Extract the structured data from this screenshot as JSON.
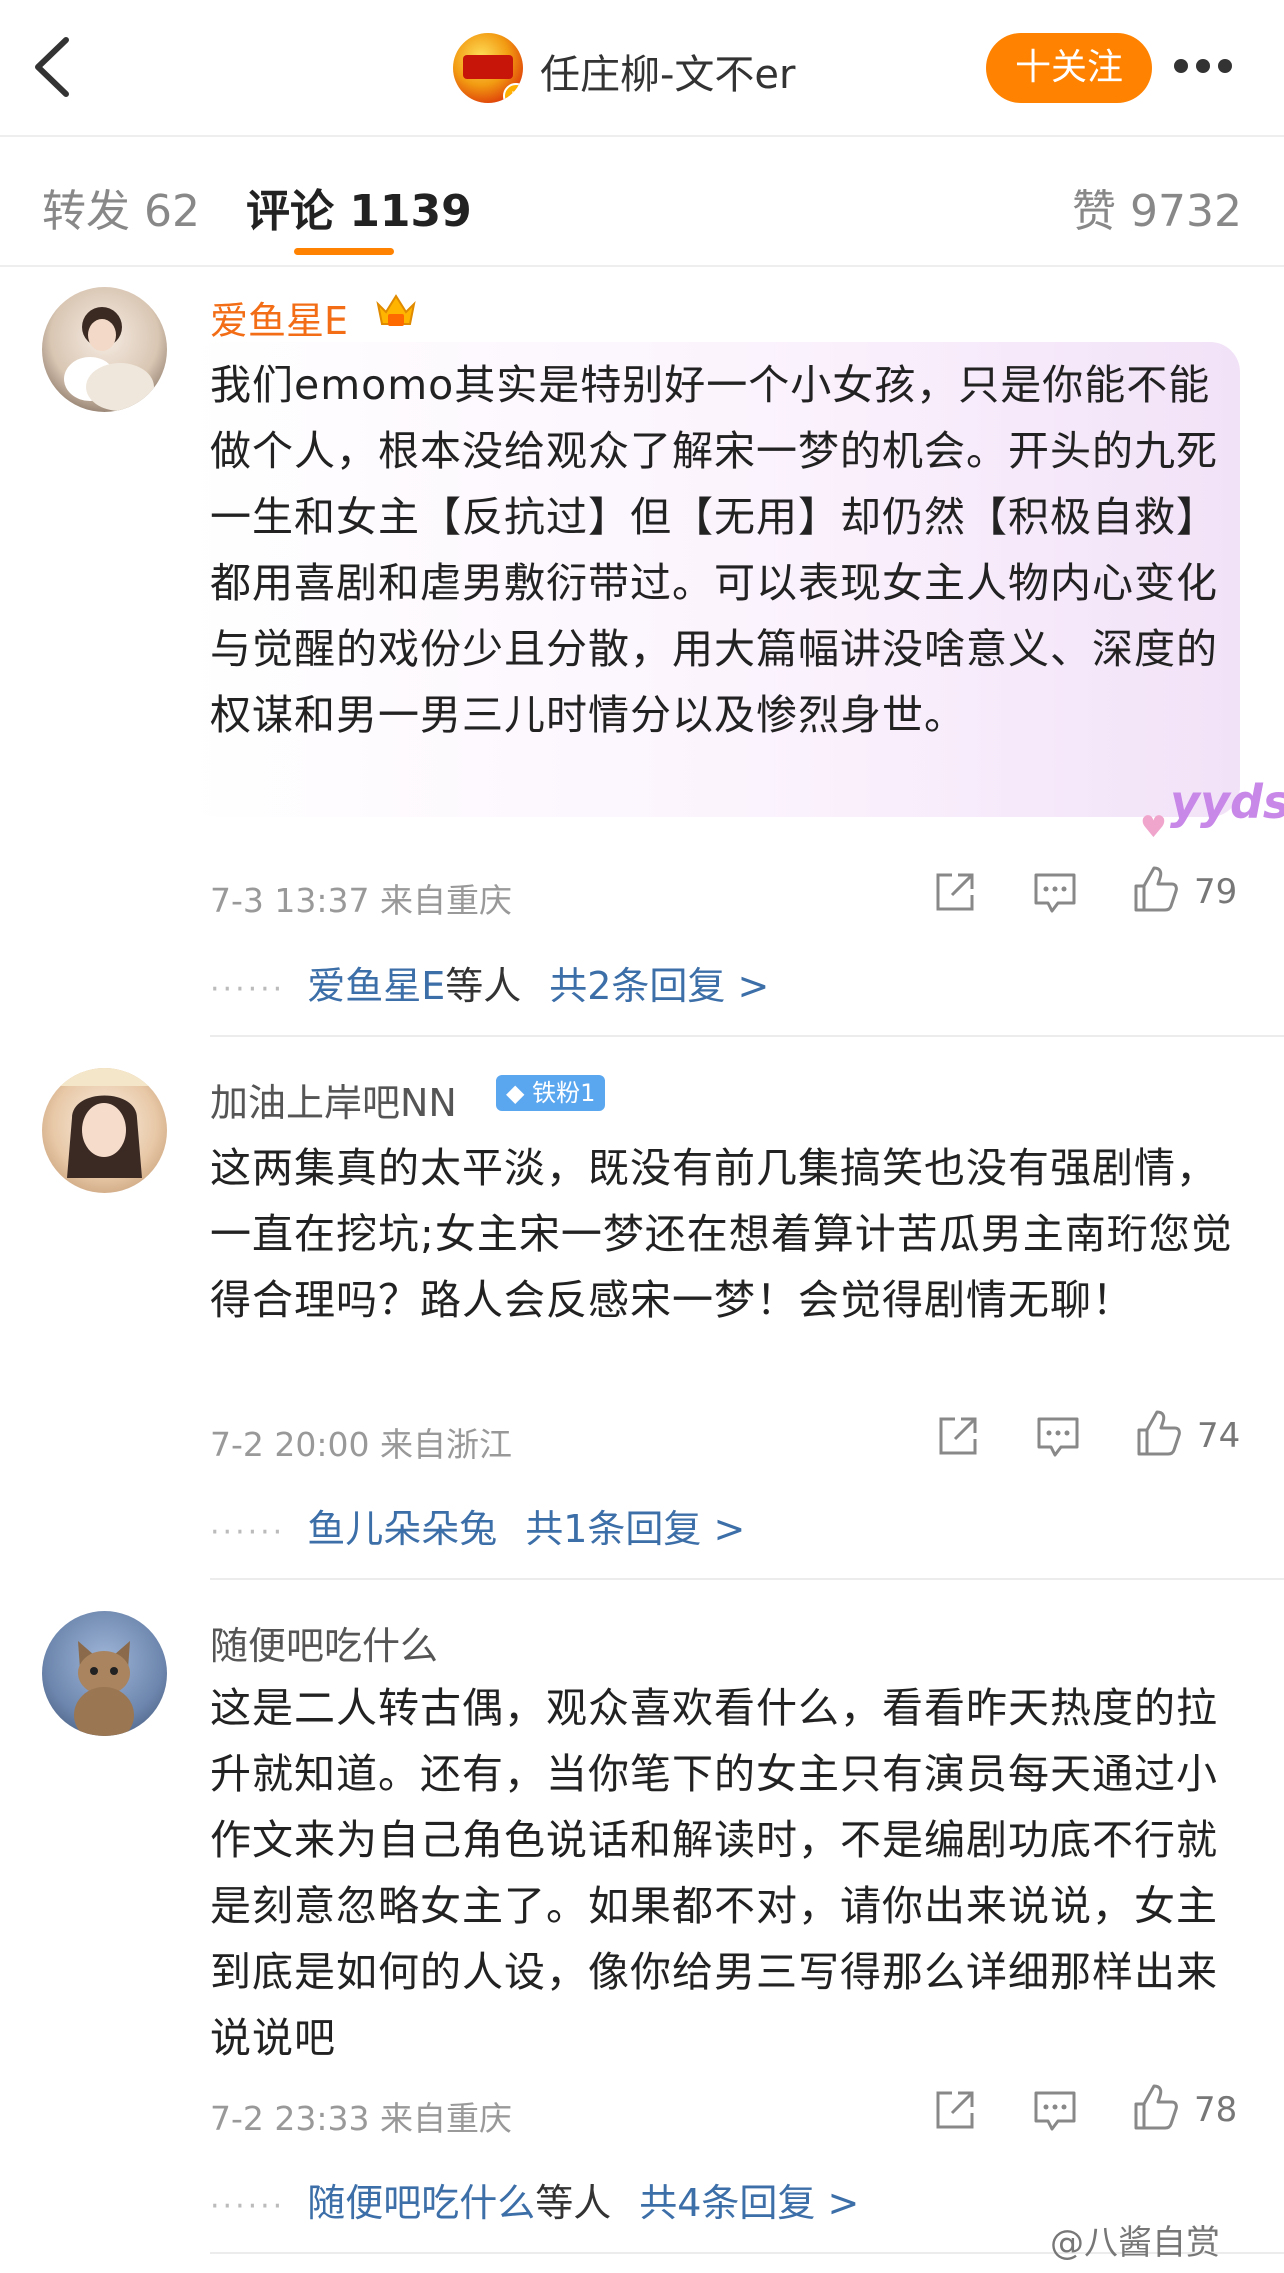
{
  "header": {
    "author_name": "任庄柳-文不er",
    "follow_label": "十关注"
  },
  "tabs": {
    "reposts": "转发 62",
    "comments": "评论 1139",
    "likes": "赞 9732"
  },
  "comments": [
    {
      "username": "爱鱼星E",
      "username_color": "#f26d16",
      "text": "我们emomo其实是特别好一个小女孩，只是你能不能做个人，根本没给观众了解宋一梦的机会。开头的九死一生和女主【反抗过】但【无用】却仍然【积极自救】都用喜剧和虐男敷衍带过。可以表现女主人物内心变化与觉醒的戏份少且分散，用大篇幅讲没啥意义、深度的权谋和男一男三儿时情分以及惨烈身世。",
      "sticker": "yyds",
      "meta": "7-3 13:37  来自重庆",
      "likes": "79",
      "reply_names": "爱鱼星E",
      "reply_suffix": "等人",
      "reply_count": "共2条回复 >"
    },
    {
      "username": "加油上岸吧NN",
      "badge": "铁粉1",
      "text": "这两集真的太平淡，既没有前几集搞笑也没有强剧情，一直在挖坑;女主宋一梦还在想着算计苦瓜男主南珩您觉得合理吗？路人会反感宋一梦！会觉得剧情无聊！",
      "meta": "7-2 20:00  来自浙江",
      "likes": "74",
      "reply_names": "鱼儿朵朵兔",
      "reply_suffix": "",
      "reply_count": "共1条回复 >"
    },
    {
      "username": "随便吧吃什么",
      "text": "这是二人转古偶，观众喜欢看什么，看看昨天热度的拉升就知道。还有，当你笔下的女主只有演员每天通过小作文来为自己角色说话和解读时，不是编剧功底不行就是刻意忽略女主了。如果都不对，请你出来说说，女主到底是如何的人设，像你给男三写得那么详细那样出来说说吧",
      "meta": "7-2 23:33  来自重庆",
      "likes": "78",
      "reply_names": "随便吧吃什么",
      "reply_suffix": "等人",
      "reply_count": "共4条回复 >"
    }
  ],
  "reply_dots": "······",
  "watermark": "@八酱自赏",
  "colors": {
    "accent": "#ff8200",
    "link": "#3c6ea8",
    "meta": "#999999"
  }
}
